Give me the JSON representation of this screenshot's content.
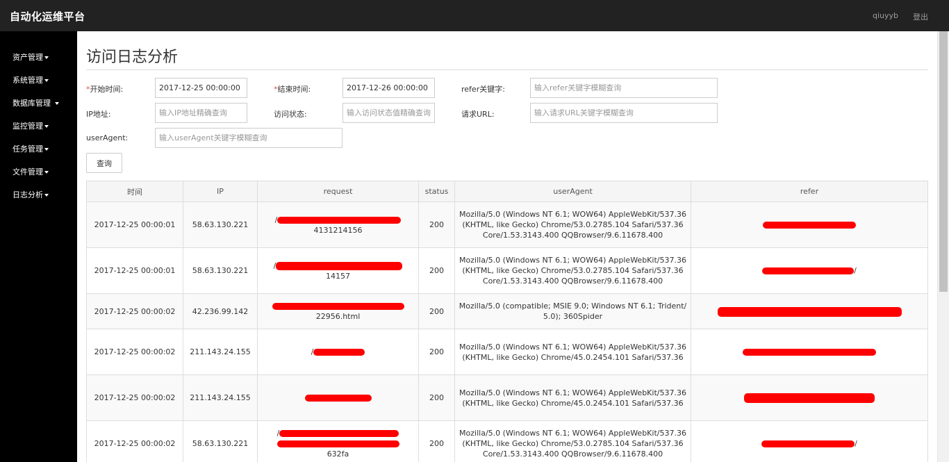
{
  "app": {
    "title": "自动化运维平台",
    "user": "qiuyyb",
    "logout": "登出"
  },
  "sidebar": {
    "items": [
      {
        "label": "资产管理"
      },
      {
        "label": "系统管理"
      },
      {
        "label": "数据库管理"
      },
      {
        "label": "监控管理"
      },
      {
        "label": "任务管理"
      },
      {
        "label": "文件管理"
      },
      {
        "label": "日志分析"
      }
    ]
  },
  "page": {
    "title": "访问日志分析"
  },
  "form": {
    "start_label_req": "*",
    "start_label": "开始时间:",
    "start_value": "2017-12-25 00:00:00",
    "end_label_req": "*",
    "end_label": "结束时间:",
    "end_value": "2017-12-26 00:00:00",
    "refer_label": "refer关键字:",
    "refer_placeholder": "输入refer关键字模糊查询",
    "ip_label": "IP地址:",
    "ip_placeholder": "输入IP地址精确查询",
    "status_label": "访问状态:",
    "status_placeholder": "输入访问状态值精确查询",
    "url_label": "请求URL:",
    "url_placeholder": "输入请求URL关键字模糊查询",
    "ua_label": "userAgent:",
    "ua_placeholder": "输入userAgent关键字模糊查询",
    "query_button": "查询"
  },
  "table": {
    "columns": [
      "时间",
      "IP",
      "request",
      "status",
      "userAgent",
      "refer"
    ],
    "rows": [
      {
        "time": "2017-12-25 00:00:01",
        "ip": "58.63.130.221",
        "request_prefix": "/",
        "request_suffix": "4131214156",
        "status": "200",
        "userAgent": "Mozilla/5.0 (Windows NT 6.1; WOW64) AppleWebKit/537.36 (KHTML, like Gecko) Chrome/53.0.2785.104 Safari/537.36 Core/1.53.3143.400 QQBrowser/9.6.11678.400",
        "refer_prefix": "",
        "refer_suffix": ""
      },
      {
        "time": "2017-12-25 00:00:01",
        "ip": "58.63.130.221",
        "request_prefix": "/",
        "request_suffix": "14157",
        "status": "200",
        "userAgent": "Mozilla/5.0 (Windows NT 6.1; WOW64) AppleWebKit/537.36 (KHTML, like Gecko) Chrome/53.0.2785.104 Safari/537.36 Core/1.53.3143.400 QQBrowser/9.6.11678.400",
        "refer_prefix": "",
        "refer_suffix": "/"
      },
      {
        "time": "2017-12-25 00:00:02",
        "ip": "42.236.99.142",
        "request_prefix": "",
        "request_suffix": "22956.html",
        "status": "200",
        "userAgent": "Mozilla/5.0 (compatible; MSIE 9.0; Windows NT 6.1; Trident/5.0); 360Spider",
        "refer_prefix": "",
        "refer_suffix": ""
      },
      {
        "time": "2017-12-25 00:00:02",
        "ip": "211.143.24.155",
        "request_prefix": "/",
        "request_suffix": "",
        "status": "200",
        "userAgent": "Mozilla/5.0 (Windows NT 6.1; WOW64) AppleWebKit/537.36 (KHTML, like Gecko) Chrome/45.0.2454.101 Safari/537.36",
        "refer_prefix": "",
        "refer_suffix": ""
      },
      {
        "time": "2017-12-25 00:00:02",
        "ip": "211.143.24.155",
        "request_prefix": "",
        "request_suffix": "",
        "status": "200",
        "userAgent": "Mozilla/5.0 (Windows NT 6.1; WOW64) AppleWebKit/537.36 (KHTML, like Gecko) Chrome/45.0.2454.101 Safari/537.36",
        "refer_prefix": "",
        "refer_suffix": ""
      },
      {
        "time": "2017-12-25 00:00:02",
        "ip": "58.63.130.221",
        "request_prefix": "/",
        "request_suffix": "632fa",
        "status": "200",
        "userAgent": "Mozilla/5.0 (Windows NT 6.1; WOW64) AppleWebKit/537.36 (KHTML, like Gecko) Chrome/53.0.2785.104 Safari/537.36 Core/1.53.3143.400 QQBrowser/9.6.11678.400",
        "refer_prefix": "",
        "refer_suffix": "/"
      }
    ]
  },
  "colors": {
    "topbar": "#222222",
    "sidebar": "#000000",
    "redaction": "#ff0000"
  }
}
